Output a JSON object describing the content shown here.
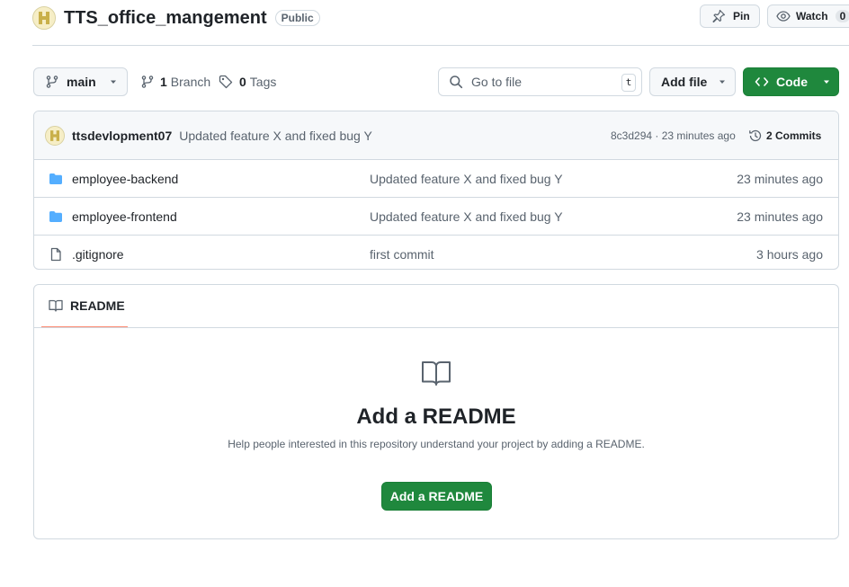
{
  "repo": {
    "name": "TTS_office_mangement",
    "visibility": "Public",
    "pin_label": "Pin",
    "watch_label": "Watch",
    "watch_count": "0"
  },
  "toolbar": {
    "branch": "main",
    "branches_count": "1",
    "branches_label": "Branch",
    "tags_count": "0",
    "tags_label": "Tags",
    "goto_placeholder": "Go to file",
    "goto_shortcut": "t",
    "add_file_label": "Add file",
    "code_label": "Code"
  },
  "latest_commit": {
    "author": "ttsdevlopment07",
    "message": "Updated feature X and fixed bug Y",
    "hash_time": "8c3d294 · 23 minutes ago",
    "commits_label": "2 Commits"
  },
  "files": [
    {
      "type": "folder",
      "name": "employee-backend",
      "message": "Updated feature X and fixed bug Y",
      "date": "23 minutes ago"
    },
    {
      "type": "folder",
      "name": "employee-frontend",
      "message": "Updated feature X and fixed bug Y",
      "date": "23 minutes ago"
    },
    {
      "type": "file",
      "name": ".gitignore",
      "message": "first commit",
      "date": "3 hours ago"
    }
  ],
  "readme": {
    "tab_label": "README",
    "title": "Add a README",
    "subtitle": "Help people interested in this repository understand your project by adding a README.",
    "button_label": "Add a README"
  },
  "colors": {
    "primary_green": "#1f883d",
    "folder_blue": "#54aeff",
    "tab_underline": "#fd8c73"
  }
}
